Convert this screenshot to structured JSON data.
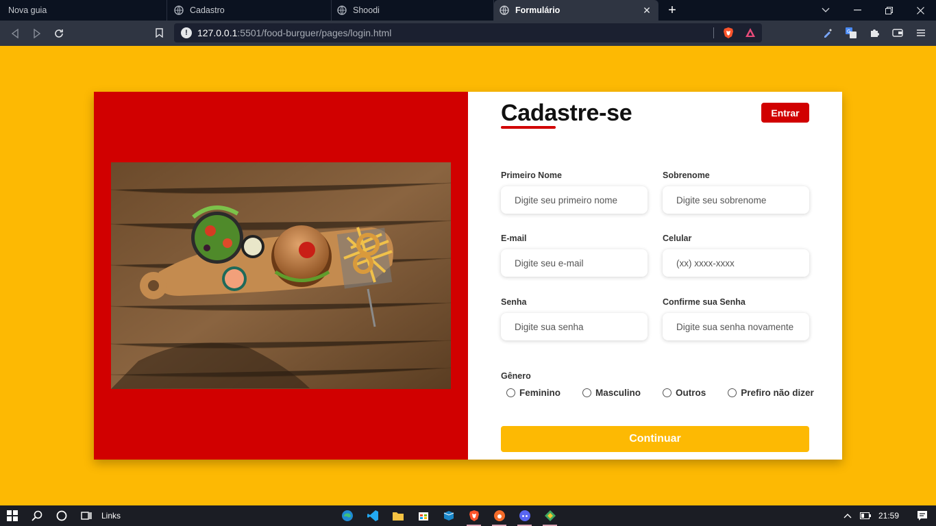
{
  "browser": {
    "tabs": [
      {
        "label": "Nova guia",
        "active": false
      },
      {
        "label": "Cadastro",
        "active": false
      },
      {
        "label": "Shoodi",
        "active": false
      },
      {
        "label": "Formulário",
        "active": true
      }
    ],
    "url_host": "127.0.0.1",
    "url_rest": ":5501/food-burguer/pages/login.html"
  },
  "form": {
    "title": "Cadastre-se",
    "login_button": "Entrar",
    "fields": {
      "first_name": {
        "label": "Primeiro Nome",
        "placeholder": "Digite seu primeiro nome"
      },
      "last_name": {
        "label": "Sobrenome",
        "placeholder": "Digite seu sobrenome"
      },
      "email": {
        "label": "E-mail",
        "placeholder": "Digite seu e-mail"
      },
      "phone": {
        "label": "Celular",
        "placeholder": "(xx) xxxx-xxxx"
      },
      "password": {
        "label": "Senha",
        "placeholder": "Digite sua senha"
      },
      "confirm_password": {
        "label": "Confirme sua Senha",
        "placeholder": "Digite sua senha novamente"
      }
    },
    "gender": {
      "title": "Gênero",
      "options": [
        "Feminino",
        "Masculino",
        "Outros",
        "Prefiro não dizer"
      ]
    },
    "continue_button": "Continuar"
  },
  "taskbar": {
    "links_label": "Links",
    "time": "21:59"
  },
  "colors": {
    "page_bg": "#fdb903",
    "accent_red": "#d10000",
    "button_yellow": "#fdb903"
  }
}
